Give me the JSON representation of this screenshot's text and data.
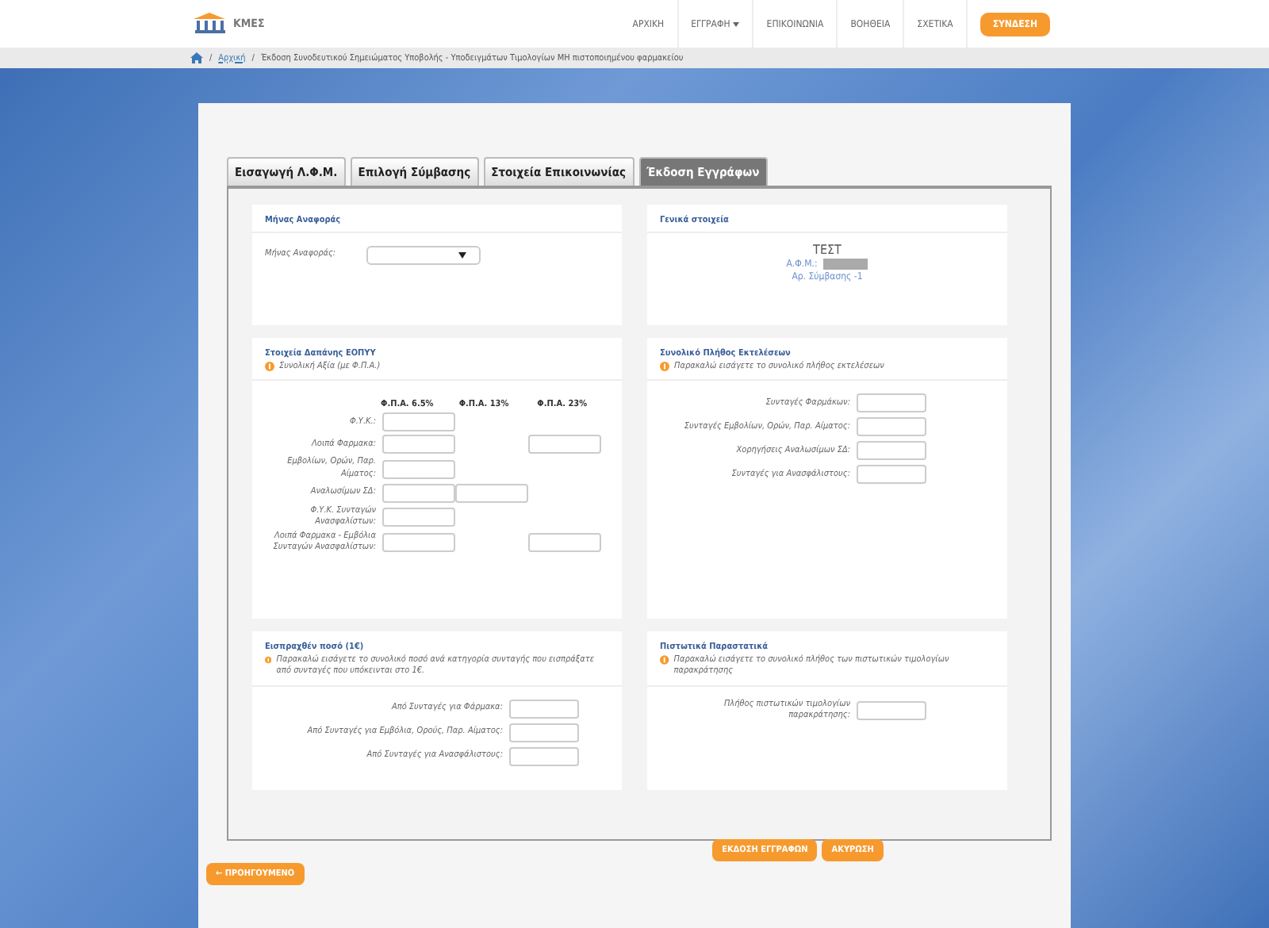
{
  "header": {
    "logo_text": "ΚΜΕΣ",
    "nav": [
      {
        "label": "ΑΡΧΙΚΗ",
        "dropdown": false
      },
      {
        "label": "ΕΓΓΡΑΦΗ",
        "dropdown": true
      },
      {
        "label": "ΕΠΙΚΟΙΝΩΝΙΑ",
        "dropdown": false
      },
      {
        "label": "ΒΟΗΘΕΙΑ",
        "dropdown": false
      },
      {
        "label": "ΣΧΕΤΙΚΑ",
        "dropdown": false
      }
    ],
    "login_button": "ΣΥΝΔΕΣΗ"
  },
  "breadcrumb_separators": [
    "/",
    "/"
  ],
  "breadcrumb": [
    "Αρχική",
    "Έκδοση Συνοδευτικού Σημειώματος Υποβολής - Υποδειγμάτων Τιμολογίων ΜΗ πιστοποιημένου φαρμακείου"
  ],
  "tabs": [
    {
      "label": "Εισαγωγή Λ.Φ.Μ.",
      "selected": false
    },
    {
      "label": "Επιλογή Σύμβασης",
      "selected": false
    },
    {
      "label": "Στοιχεία Επικοινωνίας",
      "selected": false
    },
    {
      "label": "Έκδοση Εγγράφων",
      "selected": true
    }
  ],
  "month_panel": {
    "title": "Μήνας Αναφοράς",
    "label": "Μήνας Αναφοράς:"
  },
  "general_panel": {
    "title": "Γενικά στοιχεία",
    "name": "ΤΕΣΤ",
    "afm_label": "Α.Φ.Μ.:",
    "contract": "Αρ. Σύμβασης -1"
  },
  "expense_panel": {
    "title": "Στοιχεία Δαπάνης ΕΟΠΥΥ",
    "note": "Συνολική Αξία (με Φ.Π.Α.)",
    "columns": [
      "Φ.Π.Α. 6.5%",
      "Φ.Π.Α. 13%",
      "Φ.Π.Α. 23%"
    ],
    "rows": [
      {
        "label": "Φ.Υ.Κ.:",
        "fields": [
          true,
          false,
          false
        ]
      },
      {
        "label": "Λοιπά Φαρμακα:",
        "fields": [
          true,
          false,
          true
        ]
      },
      {
        "label": "Εμβολίων, Ορών, Παρ. Αίματος:",
        "fields": [
          true,
          false,
          false
        ]
      },
      {
        "label": "Αναλωσίμων ΣΔ:",
        "fields": [
          true,
          true,
          false
        ]
      },
      {
        "label": "Φ.Υ.Κ. Συνταγών Ανασφαλίστων:",
        "fields": [
          true,
          false,
          false
        ]
      },
      {
        "label": "Λοιπά Φαρμακα - Εμβόλια Συνταγών Ανασφαλίστων:",
        "fields": [
          true,
          false,
          true
        ]
      }
    ]
  },
  "executions_panel": {
    "title": "Συνολικό Πλήθος Εκτελέσεων",
    "note": "Παρακαλώ εισάγετε το συνολικό πλήθος εκτελέσεων",
    "rows": [
      "Συνταγές Φαρμάκων:",
      "Συνταγές Εμβολίων, Ορών, Παρ. Αίματος:",
      "Χορηγήσεις Αναλωσίμων ΣΔ:",
      "Συνταγές για Ανασφάλιστους:"
    ]
  },
  "collected_panel": {
    "title": "Εισπραχθέν ποσό (1€)",
    "note": "Παρακαλώ εισάγετε το συνολικό ποσό ανά κατηγορία συνταγής που εισπράξατε από συνταγές που υπόκεινται στο 1€.",
    "rows": [
      "Από Συνταγές για Φάρμακα:",
      "Από Συνταγές για Εμβόλια, Ορούς, Παρ. Αίματος:",
      "Από Συνταγές για Ανασφάλιστους:"
    ]
  },
  "credit_panel": {
    "title": "Πιστωτικά Παραστατικά",
    "note": "Παρακαλώ εισάγετε το συνολικό πλήθος των πιστωτικών τιμολογίων παρακράτησης",
    "rows": [
      "Πλήθος πιστωτικών τιμολογίων παρακράτησης:"
    ]
  },
  "actions": [
    "ΕΚΔΟΣΗ ΕΓΓΡΑΦΩΝ",
    "ΑΚΥΡΩΣΗ"
  ],
  "previous_button": {
    "arrow": "←",
    "label": "ΠΡΟΗΓΟΥΜΕΝΟ"
  }
}
